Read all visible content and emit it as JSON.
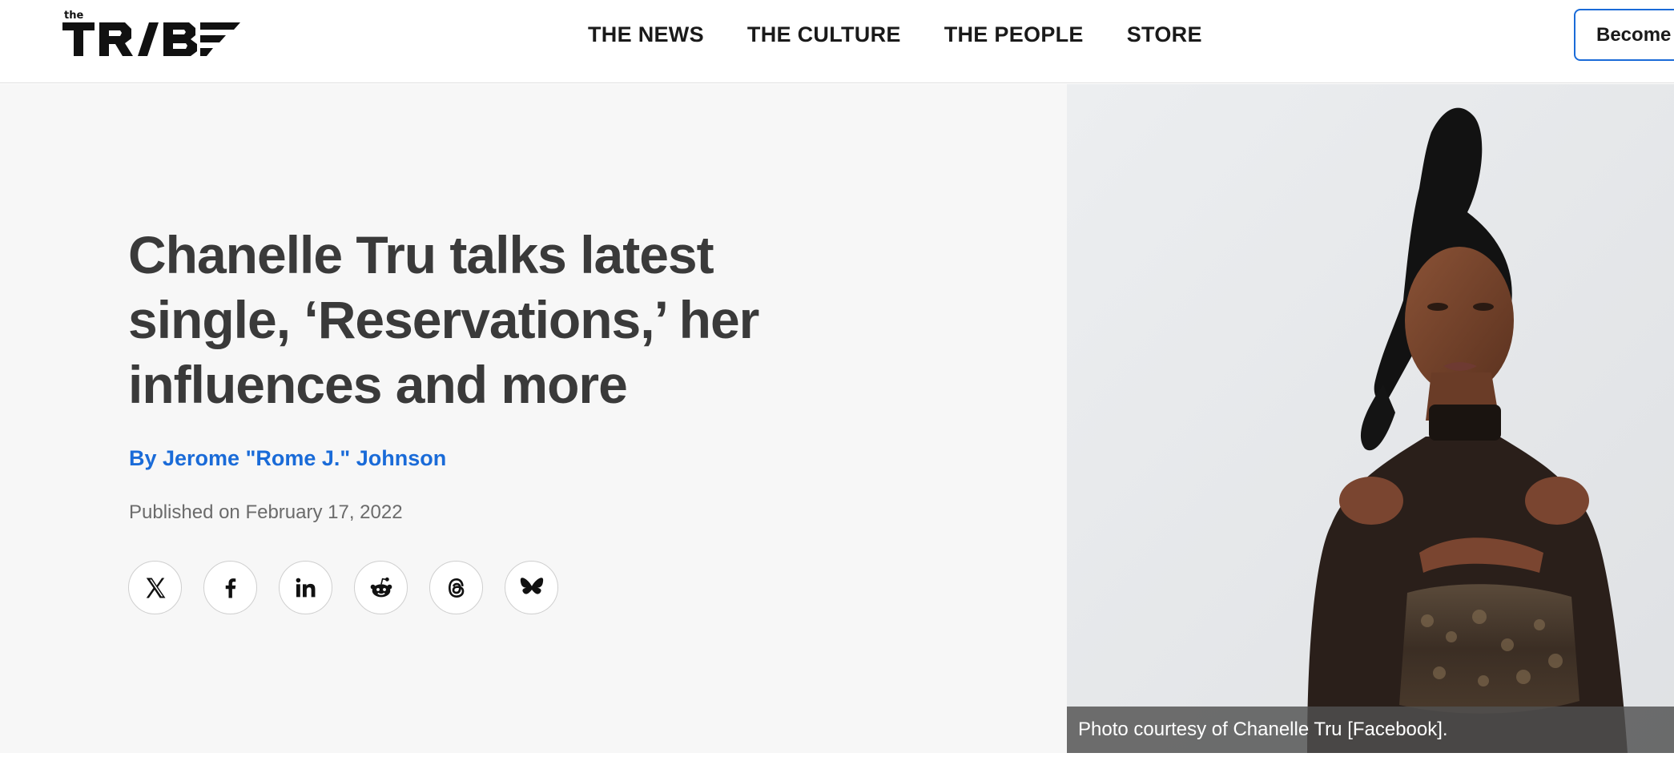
{
  "header": {
    "logo": {
      "small_text": "the",
      "wordmark": "TRIBE"
    },
    "nav": [
      {
        "label": "THE NEWS"
      },
      {
        "label": "THE CULTURE"
      },
      {
        "label": "THE PEOPLE"
      },
      {
        "label": "STORE"
      }
    ],
    "cta_label": "Become"
  },
  "article": {
    "title": "Chanelle Tru talks latest single, ‘Reservations,’ her influences and more",
    "byline": "By Jerome \"Rome J.\" Johnson",
    "published": "Published on February 17, 2022",
    "share_icons": [
      "x-icon",
      "facebook-icon",
      "linkedin-icon",
      "reddit-icon",
      "threads-icon",
      "bluesky-icon"
    ],
    "image_caption": "Photo courtesy of Chanelle Tru [Facebook]."
  },
  "colors": {
    "accent": "#1a6bd8",
    "title": "#3a3a3a",
    "hero_background": "#f7f7f7"
  }
}
